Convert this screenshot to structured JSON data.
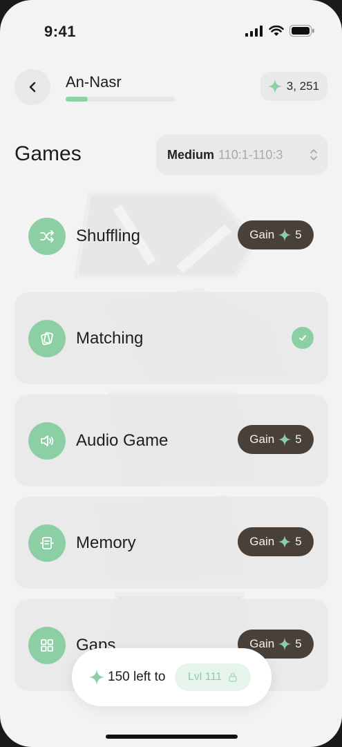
{
  "status_bar": {
    "time": "9:41"
  },
  "header": {
    "name": "An-Nasr",
    "progress": 0.2,
    "points": "3, 251"
  },
  "section": {
    "title": "Games",
    "difficulty_level": "Medium",
    "difficulty_range": "110:1-110:3"
  },
  "games": [
    {
      "label": "Shuffling",
      "icon": "shuffle-icon",
      "state": "gain",
      "gain_label": "Gain",
      "gain_value": "5"
    },
    {
      "label": "Matching",
      "icon": "cards-icon",
      "state": "done"
    },
    {
      "label": "Audio Game",
      "icon": "speaker-icon",
      "state": "gain",
      "gain_label": "Gain",
      "gain_value": "5"
    },
    {
      "label": "Memory",
      "icon": "memory-icon",
      "state": "gain",
      "gain_label": "Gain",
      "gain_value": "5"
    },
    {
      "label": "Gaps",
      "icon": "grid-icon",
      "state": "gain",
      "gain_label": "Gain",
      "gain_value": "5"
    }
  ],
  "footer": {
    "left_text": "150 left to",
    "level_text": "Lvl 111"
  },
  "colors": {
    "accent_green": "#8ccfa5",
    "pill_dark": "#4a403a",
    "background": "#f3f3f3"
  }
}
